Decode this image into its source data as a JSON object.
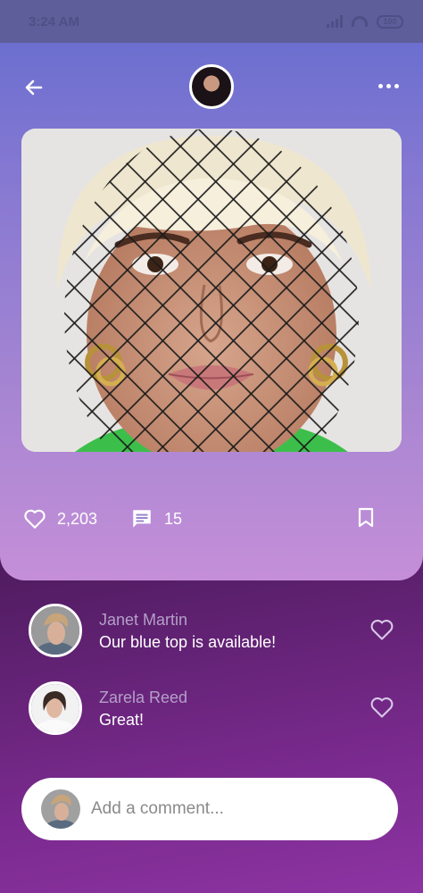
{
  "status_bar": {
    "time": "3:24 AM",
    "battery": "100"
  },
  "header": {
    "back_icon": "arrow-left-icon",
    "more_icon": "more-horizontal-icon",
    "avatar_alt": "Kylie"
  },
  "post": {
    "likes": "2,203",
    "comments": "15",
    "like_icon": "heart-outline-icon",
    "comment_icon": "comment-icon",
    "bookmark_icon": "bookmark-icon"
  },
  "comments": [
    {
      "name": "Janet Martin",
      "text": "Our blue top is available!"
    },
    {
      "name": "Zarela Reed",
      "text": "Great!"
    }
  ],
  "composer": {
    "placeholder": "Add a comment..."
  },
  "colors": {
    "card_top": "#6c6fd0",
    "card_bottom": "#c58fd8",
    "background_bottom": "#8d34a3",
    "name_text": "#b4a0c8"
  }
}
